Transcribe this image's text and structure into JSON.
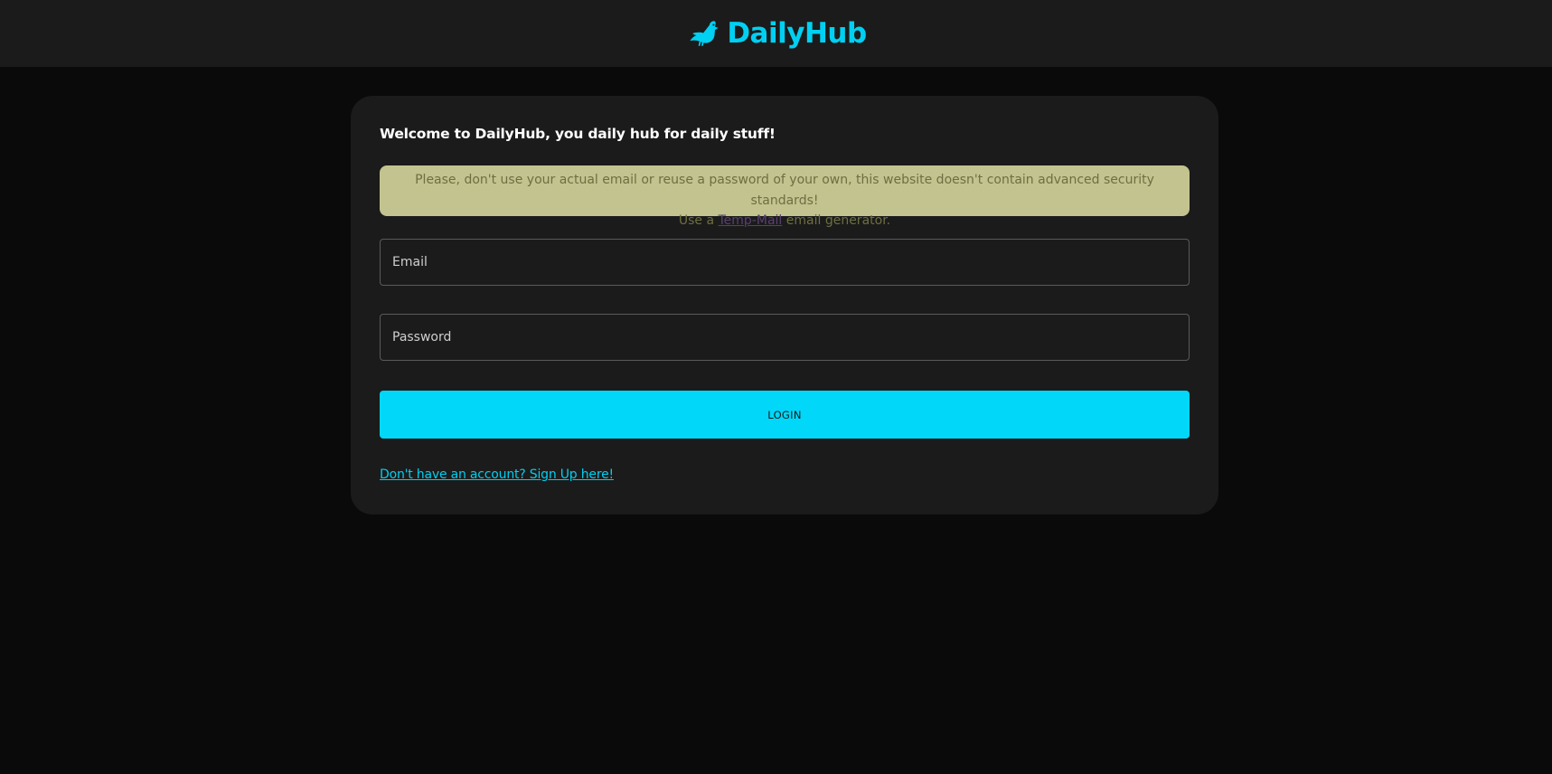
{
  "header": {
    "brand_name": "DailyHub",
    "brand_icon": "bird-icon",
    "brand_color": "#00d0f2"
  },
  "login_card": {
    "welcome_text": "Welcome to DailyHub, you daily hub for daily stuff!",
    "notice": {
      "line1": "Please, don't use your actual email or reuse a password of your own, this website doesn't contain advanced security standards!",
      "line2_prefix": "Use a ",
      "link_text": "Temp-Mail",
      "line2_suffix": " email generator.",
      "background_color": "#c3c38f"
    },
    "email_field": {
      "placeholder": "Email",
      "value": ""
    },
    "password_field": {
      "placeholder": "Password",
      "value": ""
    },
    "login_button_label": "LOGIN",
    "login_button_color": "#00d7f9",
    "signup_link_text": "Don't have an account? Sign Up here!"
  }
}
